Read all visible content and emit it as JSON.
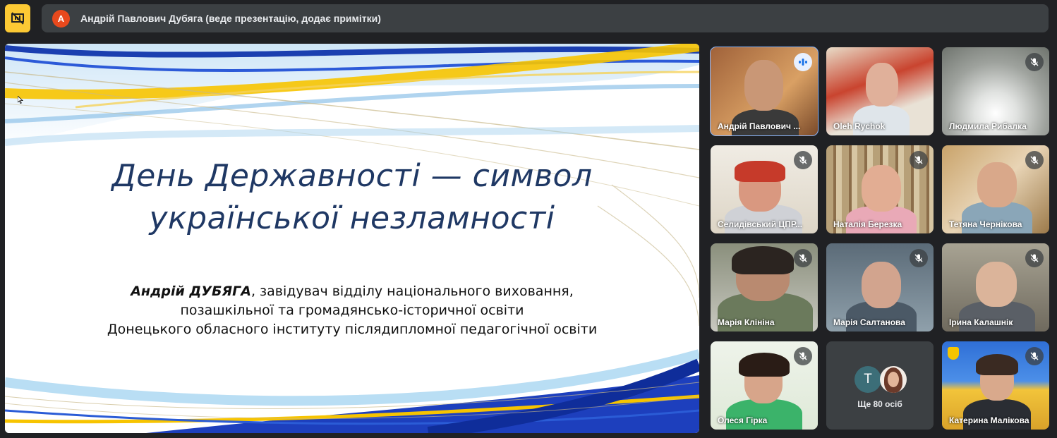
{
  "toolbar": {
    "present_icon": "presentation-off-icon"
  },
  "presenter": {
    "avatar_letter": "A",
    "label": "Андрій Павлович Дубяга (веде презентацію, додає примітки)"
  },
  "slide": {
    "title_line1": "День Державності — символ",
    "title_line2": "української незламності",
    "author_name": "Андрій ДУБЯГА",
    "body_line1_rest": ", завідувач відділу національного виховання,",
    "body_line2": "позашкільної та громадянсько-історичної освіти",
    "body_line3": "Донецького обласного інституту післядипломної педагогічної освіти"
  },
  "participants": [
    {
      "name": "Андрій Павлович ...",
      "status": "speaking"
    },
    {
      "name": "Oleh Rychok",
      "status": "unmuted"
    },
    {
      "name": "Людмила Рибалка",
      "status": "muted"
    },
    {
      "name": "Селидівський ЦПР...",
      "status": "muted"
    },
    {
      "name": "Наталія Березка",
      "status": "muted"
    },
    {
      "name": "Тетяна Чернікова",
      "status": "muted"
    },
    {
      "name": "Марія Клініна",
      "status": "muted"
    },
    {
      "name": "Марія Салтанова",
      "status": "muted"
    },
    {
      "name": "Ірина Калашнік",
      "status": "muted"
    },
    {
      "name": "Олеся Гірка",
      "status": "muted"
    },
    {
      "name": "Катерина Малікова",
      "status": "muted"
    }
  ],
  "more": {
    "avatar_letter": "T",
    "label": "Ще 80 осіб"
  },
  "colors": {
    "accent_yellow": "#fcc934",
    "slide_title": "#1f3864",
    "active_outline": "#8ab4f8",
    "tile_bg": "#3c4043"
  }
}
